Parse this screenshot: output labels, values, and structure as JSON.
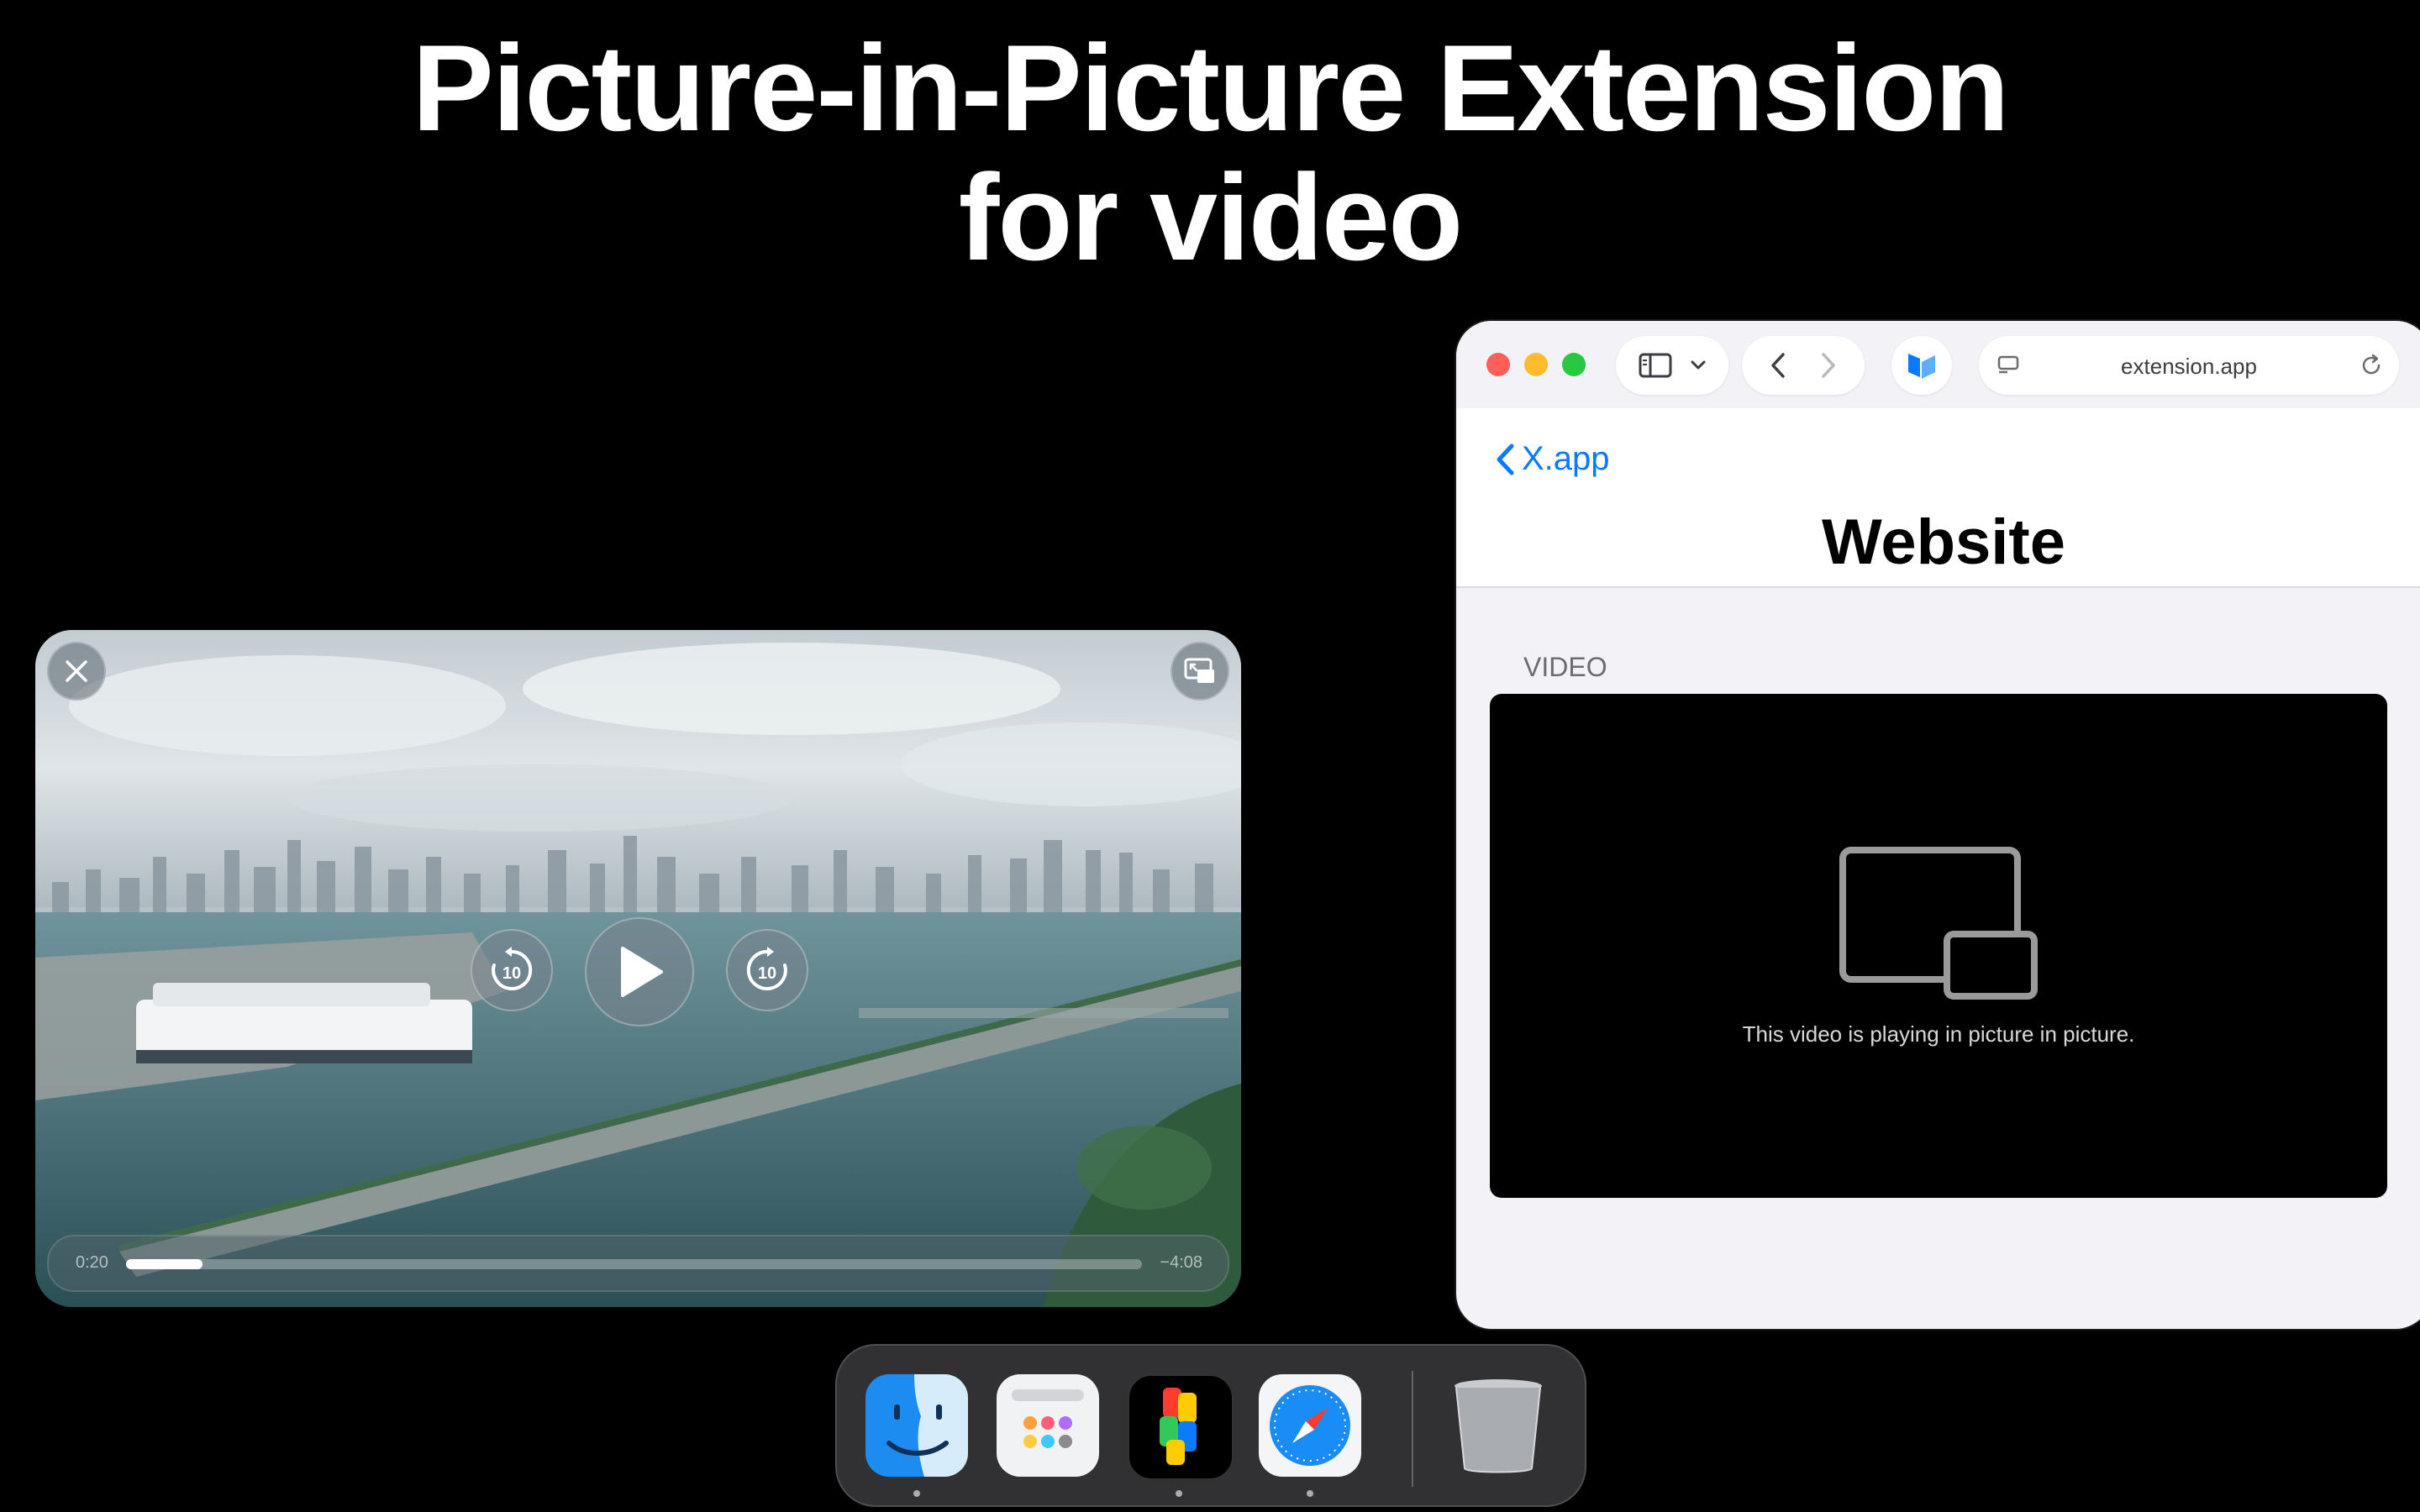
{
  "headline": {
    "line1": "Picture-in-Picture Extension",
    "line2": "for video"
  },
  "pip_player": {
    "close_icon": "close-icon",
    "restore_icon": "pip-restore-icon",
    "skip_back_label": "10",
    "skip_forward_label": "10",
    "elapsed": "0:20",
    "remaining": "−4:08",
    "progress": 0.075
  },
  "browser": {
    "url": "extension.app",
    "back_link": "X.app",
    "page_title": "Website",
    "section_label": "VIDEO",
    "video_message": "This video is playing in picture in picture.",
    "accent_color": "#0a7aff"
  },
  "dock": {
    "apps": [
      {
        "name": "Finder",
        "icon": "finder-icon",
        "running": true
      },
      {
        "name": "Launchpad",
        "icon": "launchpad-icon",
        "running": false
      },
      {
        "name": "Extension App",
        "icon": "extension-app-icon",
        "running": true
      },
      {
        "name": "Safari",
        "icon": "safari-icon",
        "running": true
      },
      {
        "name": "Trash",
        "icon": "trash-icon",
        "running": false
      }
    ]
  }
}
